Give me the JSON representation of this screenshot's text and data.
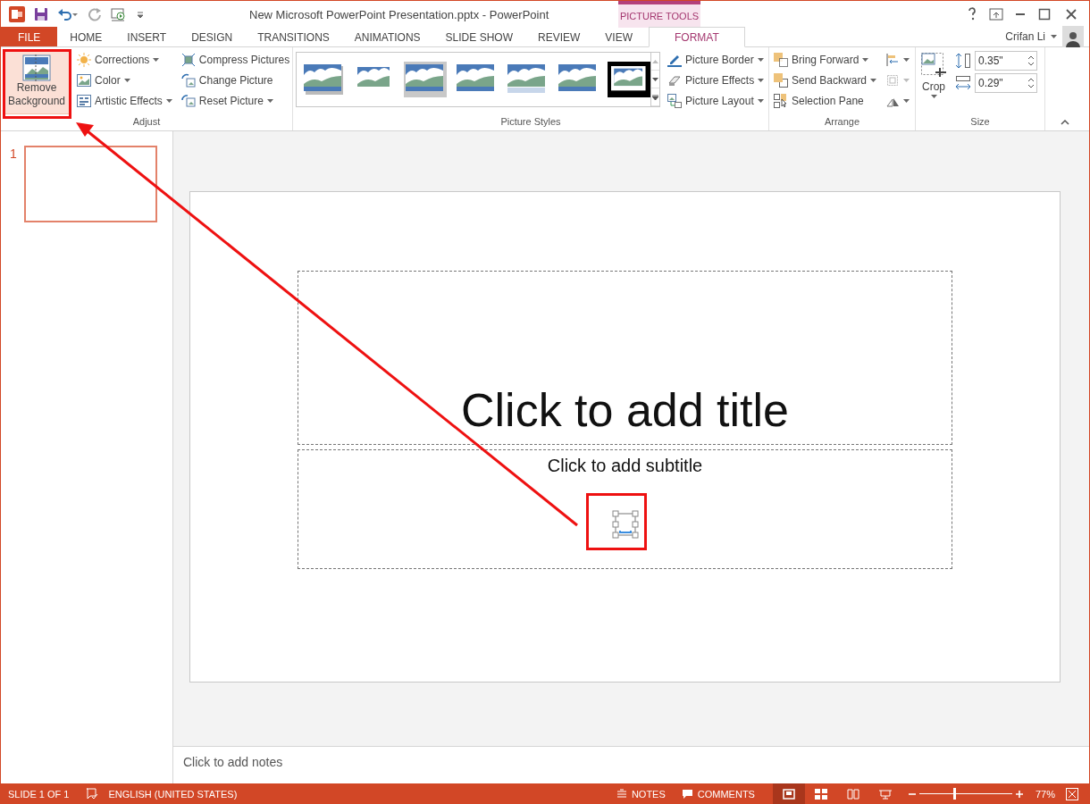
{
  "window": {
    "title": "New Microsoft PowerPoint Presentation.pptx - PowerPoint",
    "tool_context": "PICTURE TOOLS",
    "user": "Crifan Li"
  },
  "tabs": [
    {
      "label": "FILE",
      "kind": "file",
      "selected": false
    },
    {
      "label": "HOME",
      "kind": "tab",
      "selected": false
    },
    {
      "label": "INSERT",
      "kind": "tab",
      "selected": false
    },
    {
      "label": "DESIGN",
      "kind": "tab",
      "selected": false
    },
    {
      "label": "TRANSITIONS",
      "kind": "tab",
      "selected": false
    },
    {
      "label": "ANIMATIONS",
      "kind": "tab",
      "selected": false
    },
    {
      "label": "SLIDE SHOW",
      "kind": "tab",
      "selected": false
    },
    {
      "label": "REVIEW",
      "kind": "tab",
      "selected": false
    },
    {
      "label": "VIEW",
      "kind": "tab",
      "selected": false
    },
    {
      "label": "FORMAT",
      "kind": "contextual",
      "selected": true
    }
  ],
  "ribbon": {
    "adjust": {
      "label": "Adjust",
      "big_button": "Remove Background",
      "column_1": [
        {
          "label": "Corrections",
          "dropdown": true
        },
        {
          "label": "Color",
          "dropdown": true
        },
        {
          "label": "Artistic Effects",
          "dropdown": true
        }
      ],
      "column_2": [
        {
          "label": "Compress Pictures",
          "dropdown": false
        },
        {
          "label": "Change Picture",
          "dropdown": false
        },
        {
          "label": "Reset Picture",
          "dropdown": true
        }
      ]
    },
    "picture_styles": {
      "label": "Picture Styles",
      "gallery": [
        {
          "kind": "shadow"
        },
        {
          "kind": "frame"
        },
        {
          "kind": "raised"
        },
        {
          "kind": "soft"
        },
        {
          "kind": "reflection"
        },
        {
          "kind": "soft"
        },
        {
          "kind": "black-frame"
        }
      ],
      "commands": [
        {
          "label": "Picture Border",
          "dropdown": true
        },
        {
          "label": "Picture Effects",
          "dropdown": true
        },
        {
          "label": "Picture Layout",
          "dropdown": true
        }
      ]
    },
    "arrange": {
      "label": "Arrange",
      "commands": [
        {
          "label": "Bring Forward",
          "dropdown": true
        },
        {
          "label": "Send Backward",
          "dropdown": true
        },
        {
          "label": "Selection Pane",
          "dropdown": false
        }
      ]
    },
    "size": {
      "label": "Size",
      "crop": "Crop",
      "height": "0.35\"",
      "width": "0.29\""
    }
  },
  "slides_panel": [
    {
      "number": "1",
      "selected": true
    }
  ],
  "slide": {
    "title_placeholder": "Click to add title",
    "subtitle_placeholder": "Click to add subtitle"
  },
  "notes": {
    "placeholder": "Click to add notes"
  },
  "status_bar": {
    "slide": "SLIDE 1 OF 1",
    "language": "ENGLISH (UNITED STATES)",
    "notes": "NOTES",
    "comments": "COMMENTS",
    "views": [
      {
        "selected": true
      },
      {
        "selected": false
      },
      {
        "selected": false
      },
      {
        "selected": false
      }
    ],
    "zoom": {
      "level": 0.38,
      "reading": "77%"
    }
  }
}
